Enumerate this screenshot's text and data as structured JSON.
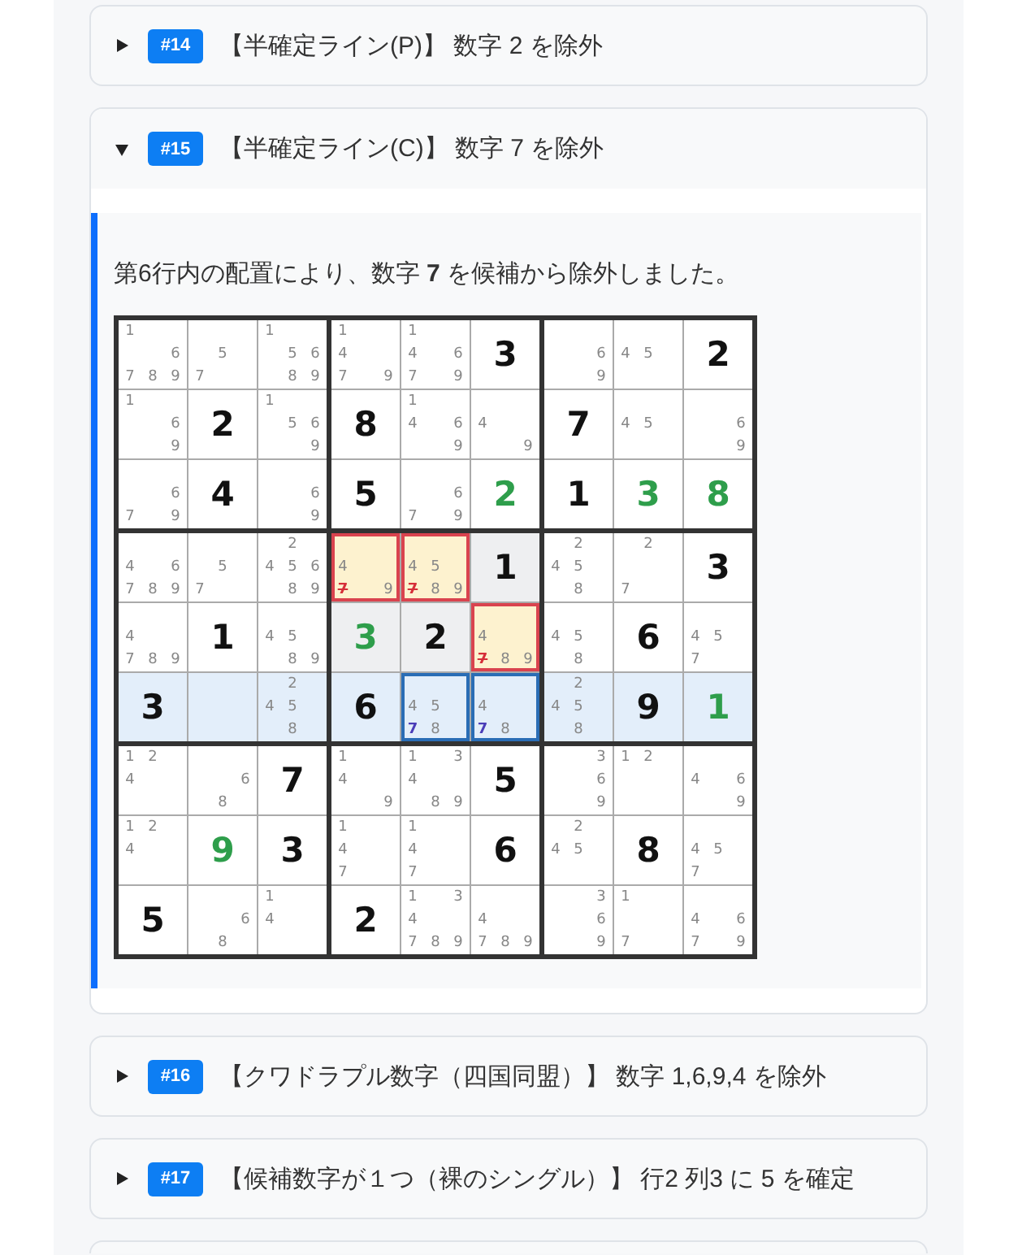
{
  "steps": [
    {
      "badge": "#14",
      "title": "【半確定ライン(P)】 数字 2 を除外",
      "expanded": false
    },
    {
      "badge": "#15",
      "title": "【半確定ライン(C)】 数字 7 を除外",
      "expanded": true,
      "detail": {
        "text": "第6行内の配置により、数字 **7** を候補から除外しました。",
        "grid": {
          "boxes": [
            {
              "highlighted": false
            },
            {
              "highlighted": false
            },
            {
              "highlighted": false
            },
            {
              "highlighted": false
            },
            {
              "highlighted": true
            },
            {
              "highlighted": false
            },
            {
              "highlighted": false
            },
            {
              "highlighted": false
            },
            {
              "highlighted": false
            }
          ],
          "rows": [
            {
              "highlighted": false,
              "cells": [
                {
                  "kind": "candidates",
                  "candidates": [
                    "1",
                    "6",
                    "7",
                    "8",
                    "9"
                  ]
                },
                {
                  "kind": "candidates",
                  "candidates": [
                    "5",
                    "7"
                  ]
                },
                {
                  "kind": "candidates",
                  "candidates": [
                    "1",
                    "5",
                    "6",
                    "8",
                    "9"
                  ]
                },
                {
                  "kind": "candidates",
                  "candidates": [
                    "1",
                    "4",
                    "7",
                    "9"
                  ]
                },
                {
                  "kind": "candidates",
                  "candidates": [
                    "1",
                    "4",
                    "6",
                    "7",
                    "9"
                  ]
                },
                {
                  "kind": "given",
                  "value": "3"
                },
                {
                  "kind": "candidates",
                  "candidates": [
                    "6",
                    "9"
                  ]
                },
                {
                  "kind": "candidates",
                  "candidates": [
                    "4",
                    "5"
                  ]
                },
                {
                  "kind": "given",
                  "value": "2"
                }
              ]
            },
            {
              "highlighted": false,
              "cells": [
                {
                  "kind": "candidates",
                  "candidates": [
                    "1",
                    "6",
                    "9"
                  ]
                },
                {
                  "kind": "given",
                  "value": "2"
                },
                {
                  "kind": "candidates",
                  "candidates": [
                    "1",
                    "5",
                    "6",
                    "9"
                  ]
                },
                {
                  "kind": "given",
                  "value": "8"
                },
                {
                  "kind": "candidates",
                  "candidates": [
                    "1",
                    "4",
                    "6",
                    "9"
                  ]
                },
                {
                  "kind": "candidates",
                  "candidates": [
                    "4",
                    "9"
                  ]
                },
                {
                  "kind": "given",
                  "value": "7"
                },
                {
                  "kind": "candidates",
                  "candidates": [
                    "4",
                    "5"
                  ]
                },
                {
                  "kind": "candidates",
                  "candidates": [
                    "6",
                    "9"
                  ]
                }
              ]
            },
            {
              "highlighted": false,
              "cells": [
                {
                  "kind": "candidates",
                  "candidates": [
                    "6",
                    "7",
                    "9"
                  ]
                },
                {
                  "kind": "given",
                  "value": "4"
                },
                {
                  "kind": "candidates",
                  "candidates": [
                    "6",
                    "9"
                  ]
                },
                {
                  "kind": "given",
                  "value": "5"
                },
                {
                  "kind": "candidates",
                  "candidates": [
                    "6",
                    "7",
                    "9"
                  ]
                },
                {
                  "kind": "solved",
                  "value": "2"
                },
                {
                  "kind": "given",
                  "value": "1"
                },
                {
                  "kind": "solved",
                  "value": "3"
                },
                {
                  "kind": "solved",
                  "value": "8"
                }
              ]
            },
            {
              "highlighted": false,
              "cells": [
                {
                  "kind": "candidates",
                  "candidates": [
                    "4",
                    "6",
                    "7",
                    "8",
                    "9"
                  ]
                },
                {
                  "kind": "candidates",
                  "candidates": [
                    "5",
                    "7"
                  ]
                },
                {
                  "kind": "candidates",
                  "candidates": [
                    "2",
                    "4",
                    "5",
                    "6",
                    "8",
                    "9"
                  ]
                },
                {
                  "kind": "candidates",
                  "candidates": [
                    "4",
                    "9"
                  ],
                  "eliminated": [
                    "7"
                  ]
                },
                {
                  "kind": "candidates",
                  "candidates": [
                    "4",
                    "5",
                    "8",
                    "9"
                  ],
                  "eliminated": [
                    "7"
                  ]
                },
                {
                  "kind": "given",
                  "value": "1"
                },
                {
                  "kind": "candidates",
                  "candidates": [
                    "2",
                    "4",
                    "5",
                    "8"
                  ]
                },
                {
                  "kind": "candidates",
                  "candidates": [
                    "2",
                    "7"
                  ]
                },
                {
                  "kind": "given",
                  "value": "3"
                }
              ]
            },
            {
              "highlighted": false,
              "cells": [
                {
                  "kind": "candidates",
                  "candidates": [
                    "4",
                    "7",
                    "8",
                    "9"
                  ]
                },
                {
                  "kind": "given",
                  "value": "1"
                },
                {
                  "kind": "candidates",
                  "candidates": [
                    "4",
                    "5",
                    "8",
                    "9"
                  ]
                },
                {
                  "kind": "solved",
                  "value": "3"
                },
                {
                  "kind": "given",
                  "value": "2"
                },
                {
                  "kind": "candidates",
                  "candidates": [
                    "4",
                    "8",
                    "9"
                  ],
                  "eliminated": [
                    "7"
                  ]
                },
                {
                  "kind": "candidates",
                  "candidates": [
                    "4",
                    "5",
                    "8"
                  ]
                },
                {
                  "kind": "given",
                  "value": "6"
                },
                {
                  "kind": "candidates",
                  "candidates": [
                    "4",
                    "5",
                    "7"
                  ]
                }
              ]
            },
            {
              "highlighted": true,
              "cells": [
                {
                  "kind": "given",
                  "value": "3"
                },
                {
                  "kind": "empty"
                },
                {
                  "kind": "candidates",
                  "candidates": [
                    "2",
                    "4",
                    "5",
                    "8"
                  ]
                },
                {
                  "kind": "given",
                  "value": "6"
                },
                {
                  "kind": "candidates",
                  "candidates": [
                    "4",
                    "5",
                    "8"
                  ],
                  "highlighted": [
                    "7"
                  ]
                },
                {
                  "kind": "candidates",
                  "candidates": [
                    "4",
                    "8"
                  ],
                  "highlighted": [
                    "7"
                  ]
                },
                {
                  "kind": "candidates",
                  "candidates": [
                    "2",
                    "4",
                    "5",
                    "8"
                  ]
                },
                {
                  "kind": "given",
                  "value": "9"
                },
                {
                  "kind": "solved",
                  "value": "1"
                }
              ]
            },
            {
              "highlighted": false,
              "cells": [
                {
                  "kind": "candidates",
                  "candidates": [
                    "1",
                    "2",
                    "4"
                  ]
                },
                {
                  "kind": "candidates",
                  "candidates": [
                    "6",
                    "8"
                  ]
                },
                {
                  "kind": "given",
                  "value": "7"
                },
                {
                  "kind": "candidates",
                  "candidates": [
                    "1",
                    "4",
                    "9"
                  ]
                },
                {
                  "kind": "candidates",
                  "candidates": [
                    "1",
                    "3",
                    "4",
                    "8",
                    "9"
                  ]
                },
                {
                  "kind": "given",
                  "value": "5"
                },
                {
                  "kind": "candidates",
                  "candidates": [
                    "3",
                    "6",
                    "9"
                  ]
                },
                {
                  "kind": "candidates",
                  "candidates": [
                    "1",
                    "2"
                  ]
                },
                {
                  "kind": "candidates",
                  "candidates": [
                    "4",
                    "6",
                    "9"
                  ]
                }
              ]
            },
            {
              "highlighted": false,
              "cells": [
                {
                  "kind": "candidates",
                  "candidates": [
                    "1",
                    "2",
                    "4"
                  ]
                },
                {
                  "kind": "solved",
                  "value": "9"
                },
                {
                  "kind": "given",
                  "value": "3"
                },
                {
                  "kind": "candidates",
                  "candidates": [
                    "1",
                    "4",
                    "7"
                  ]
                },
                {
                  "kind": "candidates",
                  "candidates": [
                    "1",
                    "4",
                    "7"
                  ]
                },
                {
                  "kind": "given",
                  "value": "6"
                },
                {
                  "kind": "candidates",
                  "candidates": [
                    "2",
                    "4",
                    "5"
                  ]
                },
                {
                  "kind": "given",
                  "value": "8"
                },
                {
                  "kind": "candidates",
                  "candidates": [
                    "4",
                    "5",
                    "7"
                  ]
                }
              ]
            },
            {
              "highlighted": false,
              "cells": [
                {
                  "kind": "given",
                  "value": "5"
                },
                {
                  "kind": "candidates",
                  "candidates": [
                    "6",
                    "8"
                  ]
                },
                {
                  "kind": "candidates",
                  "candidates": [
                    "1",
                    "4"
                  ]
                },
                {
                  "kind": "given",
                  "value": "2"
                },
                {
                  "kind": "candidates",
                  "candidates": [
                    "1",
                    "3",
                    "4",
                    "7",
                    "8",
                    "9"
                  ]
                },
                {
                  "kind": "candidates",
                  "candidates": [
                    "4",
                    "7",
                    "8",
                    "9"
                  ]
                },
                {
                  "kind": "candidates",
                  "candidates": [
                    "3",
                    "6",
                    "9"
                  ]
                },
                {
                  "kind": "candidates",
                  "candidates": [
                    "1",
                    "7"
                  ]
                },
                {
                  "kind": "candidates",
                  "candidates": [
                    "4",
                    "6",
                    "7",
                    "9"
                  ]
                }
              ]
            }
          ]
        }
      }
    },
    {
      "badge": "#16",
      "title": "【クワドラプル数字（四国同盟）】 数字 1,6,9,4 を除外",
      "expanded": false
    },
    {
      "badge": "#17",
      "title": "【候補数字が１つ（裸のシングル）】 行2 列3 に 5 を確定",
      "expanded": false
    }
  ]
}
